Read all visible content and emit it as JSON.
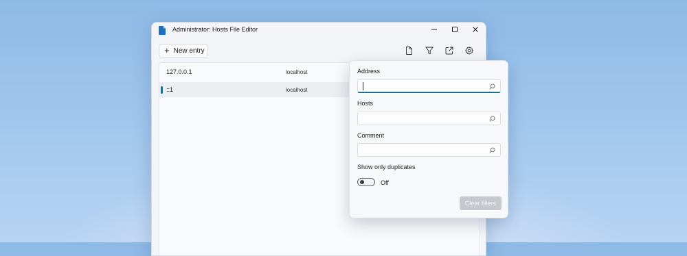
{
  "window": {
    "title": "Administrator: Hosts File Editor"
  },
  "toolbar": {
    "new_entry_label": "New entry",
    "icons": [
      "new-file-icon",
      "filter-icon",
      "open-external-icon",
      "settings-gear-icon"
    ]
  },
  "entries": [
    {
      "address": "127.0.0.1",
      "hosts": "localhost",
      "selected": false
    },
    {
      "address": "::1",
      "hosts": "localhost",
      "selected": true
    }
  ],
  "filter_panel": {
    "address_label": "Address",
    "address_value": "",
    "hosts_label": "Hosts",
    "hosts_value": "",
    "comment_label": "Comment",
    "comment_value": "",
    "duplicates_label": "Show only duplicates",
    "duplicates_toggle_state": "Off",
    "clear_button_label": "Clear filters"
  },
  "colors": {
    "accent": "#1f6e8c",
    "app_icon": "#1e6fbf",
    "disabled_button": "#c5c8cd"
  }
}
